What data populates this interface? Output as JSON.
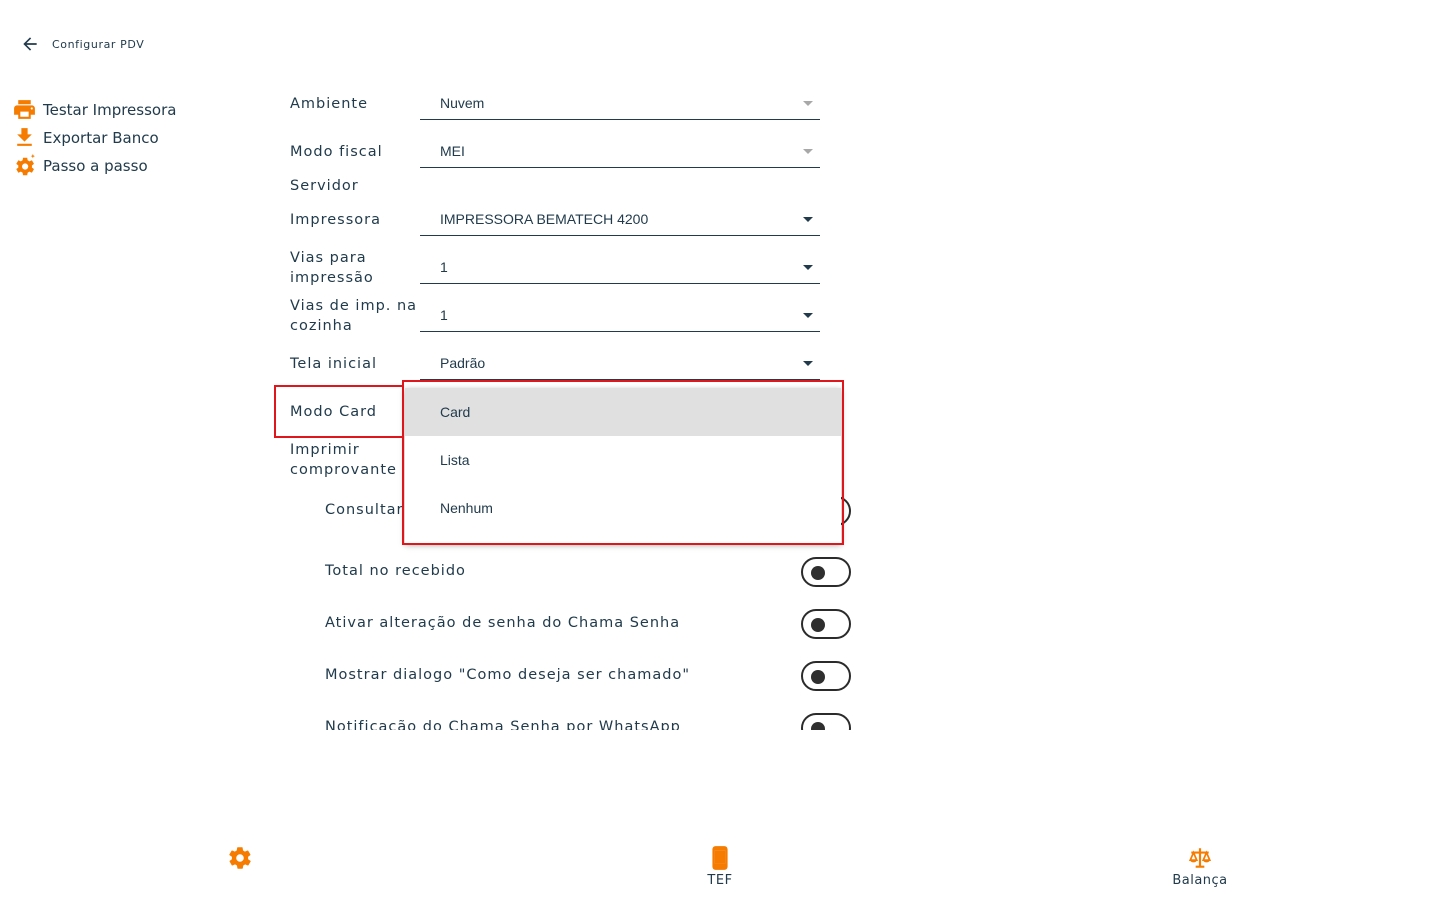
{
  "header": {
    "title": "Configurar PDV",
    "back_icon": "arrow-left-icon"
  },
  "sidebar": {
    "items": [
      {
        "label": "Testar Impressora",
        "icon": "printer-icon"
      },
      {
        "label": "Exportar Banco",
        "icon": "download-icon"
      },
      {
        "label": "Passo a passo",
        "icon": "gear-sparkle-icon"
      }
    ]
  },
  "form": {
    "ambiente": {
      "label": "Ambiente",
      "value": "Nuvem"
    },
    "modo_fiscal": {
      "label": "Modo fiscal",
      "value": "MEI"
    },
    "servidor": {
      "label": "Servidor"
    },
    "impressora": {
      "label": "Impressora",
      "value": "IMPRESSORA BEMATECH 4200"
    },
    "vias_impressao": {
      "label": "Vias para impressão",
      "value": "1"
    },
    "vias_cozinha": {
      "label": "Vias de imp. na cozinha",
      "value": "1"
    },
    "tela_inicial": {
      "label": "Tela inicial",
      "value": "Padrão"
    },
    "modo_card": {
      "label": "Modo Card"
    },
    "imprimir_comprovante": {
      "label": "Imprimir comprovante"
    }
  },
  "toggles": [
    {
      "label": "Consultar",
      "on": false
    },
    {
      "label": "Total no recebido",
      "on": false
    },
    {
      "label": "Ativar alteração de senha do Chama Senha",
      "on": false
    },
    {
      "label": "Mostrar dialogo \"Como deseja ser chamado\"",
      "on": false
    },
    {
      "label": "Notificação do Chama Senha por WhatsApp",
      "on": false
    }
  ],
  "dropdown": {
    "options": [
      {
        "label": "Card",
        "selected": true
      },
      {
        "label": "Lista",
        "selected": false
      },
      {
        "label": "Nenhum",
        "selected": false
      }
    ]
  },
  "bottom_nav": {
    "items": [
      {
        "label": "",
        "icon": "gear-icon"
      },
      {
        "label": "TEF",
        "icon": "phone-icon"
      },
      {
        "label": "Balança",
        "icon": "scale-icon"
      }
    ]
  },
  "colors": {
    "accent": "#f57c00",
    "text": "#213b4c",
    "highlight": "#e0161d",
    "selected_bg": "#e0e0e0"
  }
}
